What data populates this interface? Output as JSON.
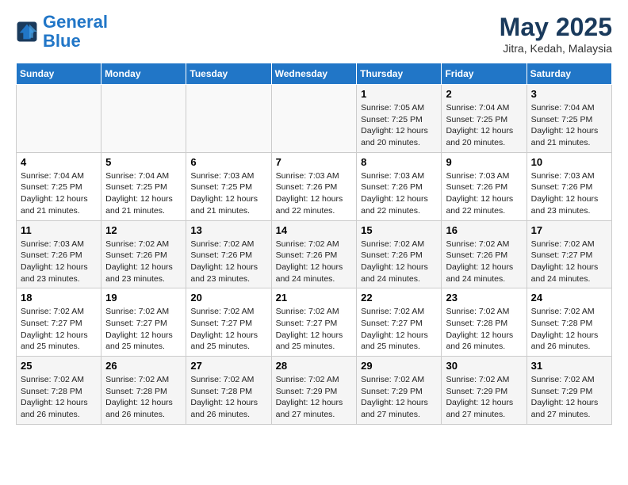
{
  "header": {
    "logo_line1": "General",
    "logo_line2": "Blue",
    "month": "May 2025",
    "location": "Jitra, Kedah, Malaysia"
  },
  "weekdays": [
    "Sunday",
    "Monday",
    "Tuesday",
    "Wednesday",
    "Thursday",
    "Friday",
    "Saturday"
  ],
  "weeks": [
    [
      {
        "day": "",
        "info": ""
      },
      {
        "day": "",
        "info": ""
      },
      {
        "day": "",
        "info": ""
      },
      {
        "day": "",
        "info": ""
      },
      {
        "day": "1",
        "info": "Sunrise: 7:05 AM\nSunset: 7:25 PM\nDaylight: 12 hours\nand 20 minutes."
      },
      {
        "day": "2",
        "info": "Sunrise: 7:04 AM\nSunset: 7:25 PM\nDaylight: 12 hours\nand 20 minutes."
      },
      {
        "day": "3",
        "info": "Sunrise: 7:04 AM\nSunset: 7:25 PM\nDaylight: 12 hours\nand 21 minutes."
      }
    ],
    [
      {
        "day": "4",
        "info": "Sunrise: 7:04 AM\nSunset: 7:25 PM\nDaylight: 12 hours\nand 21 minutes."
      },
      {
        "day": "5",
        "info": "Sunrise: 7:04 AM\nSunset: 7:25 PM\nDaylight: 12 hours\nand 21 minutes."
      },
      {
        "day": "6",
        "info": "Sunrise: 7:03 AM\nSunset: 7:25 PM\nDaylight: 12 hours\nand 21 minutes."
      },
      {
        "day": "7",
        "info": "Sunrise: 7:03 AM\nSunset: 7:26 PM\nDaylight: 12 hours\nand 22 minutes."
      },
      {
        "day": "8",
        "info": "Sunrise: 7:03 AM\nSunset: 7:26 PM\nDaylight: 12 hours\nand 22 minutes."
      },
      {
        "day": "9",
        "info": "Sunrise: 7:03 AM\nSunset: 7:26 PM\nDaylight: 12 hours\nand 22 minutes."
      },
      {
        "day": "10",
        "info": "Sunrise: 7:03 AM\nSunset: 7:26 PM\nDaylight: 12 hours\nand 23 minutes."
      }
    ],
    [
      {
        "day": "11",
        "info": "Sunrise: 7:03 AM\nSunset: 7:26 PM\nDaylight: 12 hours\nand 23 minutes."
      },
      {
        "day": "12",
        "info": "Sunrise: 7:02 AM\nSunset: 7:26 PM\nDaylight: 12 hours\nand 23 minutes."
      },
      {
        "day": "13",
        "info": "Sunrise: 7:02 AM\nSunset: 7:26 PM\nDaylight: 12 hours\nand 23 minutes."
      },
      {
        "day": "14",
        "info": "Sunrise: 7:02 AM\nSunset: 7:26 PM\nDaylight: 12 hours\nand 24 minutes."
      },
      {
        "day": "15",
        "info": "Sunrise: 7:02 AM\nSunset: 7:26 PM\nDaylight: 12 hours\nand 24 minutes."
      },
      {
        "day": "16",
        "info": "Sunrise: 7:02 AM\nSunset: 7:26 PM\nDaylight: 12 hours\nand 24 minutes."
      },
      {
        "day": "17",
        "info": "Sunrise: 7:02 AM\nSunset: 7:27 PM\nDaylight: 12 hours\nand 24 minutes."
      }
    ],
    [
      {
        "day": "18",
        "info": "Sunrise: 7:02 AM\nSunset: 7:27 PM\nDaylight: 12 hours\nand 25 minutes."
      },
      {
        "day": "19",
        "info": "Sunrise: 7:02 AM\nSunset: 7:27 PM\nDaylight: 12 hours\nand 25 minutes."
      },
      {
        "day": "20",
        "info": "Sunrise: 7:02 AM\nSunset: 7:27 PM\nDaylight: 12 hours\nand 25 minutes."
      },
      {
        "day": "21",
        "info": "Sunrise: 7:02 AM\nSunset: 7:27 PM\nDaylight: 12 hours\nand 25 minutes."
      },
      {
        "day": "22",
        "info": "Sunrise: 7:02 AM\nSunset: 7:27 PM\nDaylight: 12 hours\nand 25 minutes."
      },
      {
        "day": "23",
        "info": "Sunrise: 7:02 AM\nSunset: 7:28 PM\nDaylight: 12 hours\nand 26 minutes."
      },
      {
        "day": "24",
        "info": "Sunrise: 7:02 AM\nSunset: 7:28 PM\nDaylight: 12 hours\nand 26 minutes."
      }
    ],
    [
      {
        "day": "25",
        "info": "Sunrise: 7:02 AM\nSunset: 7:28 PM\nDaylight: 12 hours\nand 26 minutes."
      },
      {
        "day": "26",
        "info": "Sunrise: 7:02 AM\nSunset: 7:28 PM\nDaylight: 12 hours\nand 26 minutes."
      },
      {
        "day": "27",
        "info": "Sunrise: 7:02 AM\nSunset: 7:28 PM\nDaylight: 12 hours\nand 26 minutes."
      },
      {
        "day": "28",
        "info": "Sunrise: 7:02 AM\nSunset: 7:29 PM\nDaylight: 12 hours\nand 27 minutes."
      },
      {
        "day": "29",
        "info": "Sunrise: 7:02 AM\nSunset: 7:29 PM\nDaylight: 12 hours\nand 27 minutes."
      },
      {
        "day": "30",
        "info": "Sunrise: 7:02 AM\nSunset: 7:29 PM\nDaylight: 12 hours\nand 27 minutes."
      },
      {
        "day": "31",
        "info": "Sunrise: 7:02 AM\nSunset: 7:29 PM\nDaylight: 12 hours\nand 27 minutes."
      }
    ]
  ]
}
